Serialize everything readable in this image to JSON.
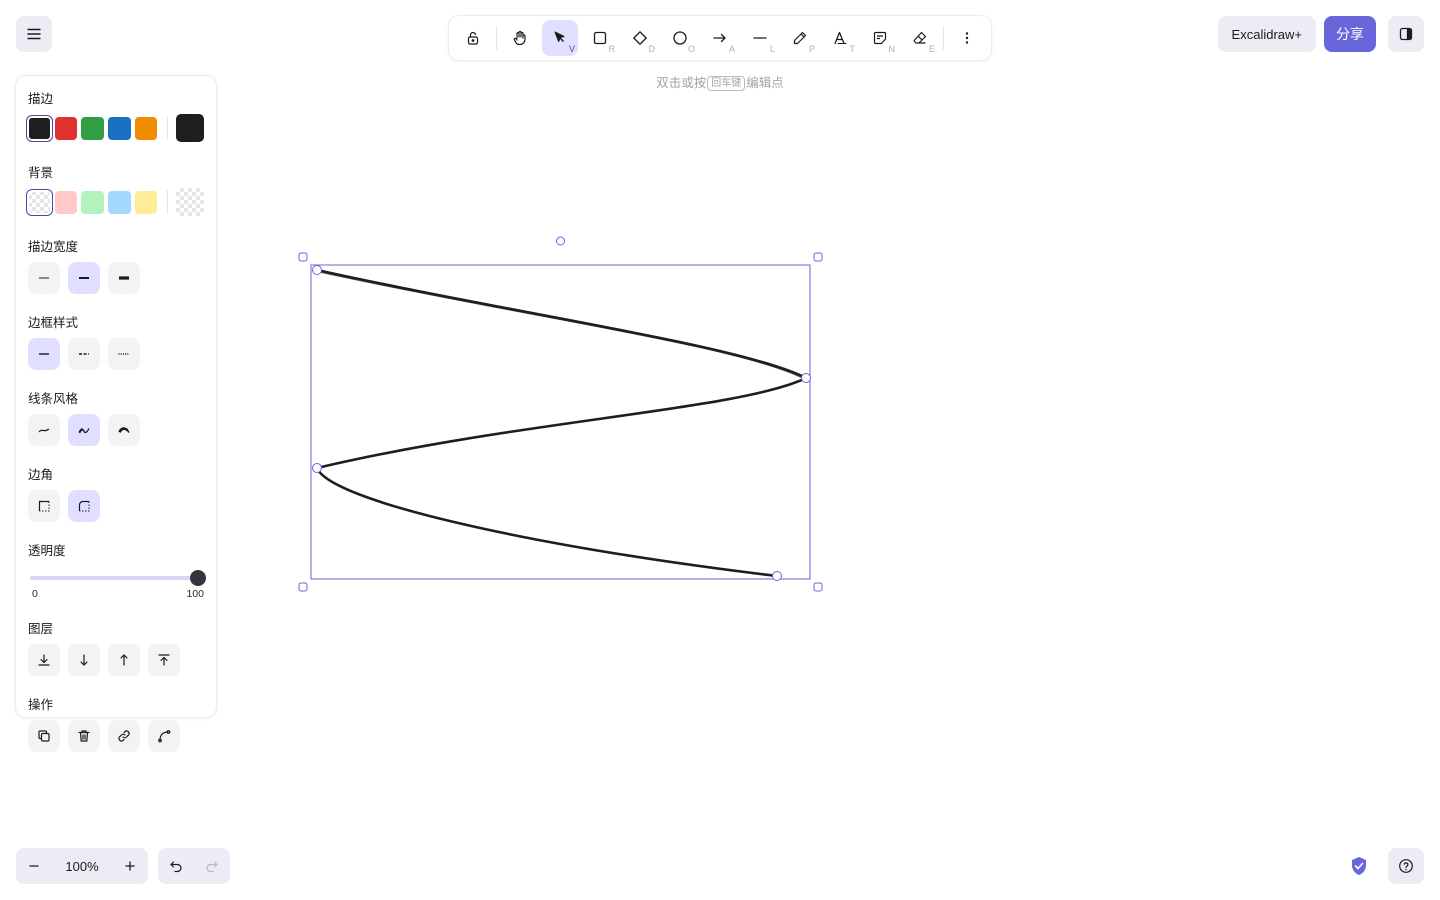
{
  "toolbar": {
    "tools": [
      {
        "name": "lock",
        "key": ""
      },
      {
        "name": "hand",
        "key": ""
      },
      {
        "name": "selection",
        "key": "V"
      },
      {
        "name": "rectangle",
        "key": "R"
      },
      {
        "name": "diamond",
        "key": "D"
      },
      {
        "name": "ellipse",
        "key": "O"
      },
      {
        "name": "arrow",
        "key": "A"
      },
      {
        "name": "line",
        "key": "L"
      },
      {
        "name": "draw",
        "key": "P"
      },
      {
        "name": "text",
        "key": "T"
      },
      {
        "name": "note",
        "key": "N"
      },
      {
        "name": "eraser",
        "key": "E"
      }
    ],
    "active_tool": "selection"
  },
  "hint": {
    "before": "双击或按",
    "key": "回车键",
    "after": "编辑点"
  },
  "header": {
    "plus_label": "Excalidraw+",
    "share_label": "分享"
  },
  "panel": {
    "stroke": {
      "label": "描边",
      "colors": [
        "#1e1e1e",
        "#e03131",
        "#2f9e44",
        "#1971c2",
        "#f08c00"
      ],
      "current": "#1e1e1e"
    },
    "background": {
      "label": "背景",
      "colors": [
        "transparent",
        "#ffc9c9",
        "#b2f2bb",
        "#a5d8ff",
        "#ffec99"
      ],
      "current": "transparent"
    },
    "stroke_width": {
      "label": "描边宽度"
    },
    "stroke_style": {
      "label": "边框样式"
    },
    "sloppiness": {
      "label": "线条风格"
    },
    "edges": {
      "label": "边角"
    },
    "opacity": {
      "label": "透明度",
      "min": "0",
      "max": "100",
      "value": 100
    },
    "layers": {
      "label": "图层"
    },
    "actions": {
      "label": "操作"
    }
  },
  "footer": {
    "zoom": "100%"
  }
}
